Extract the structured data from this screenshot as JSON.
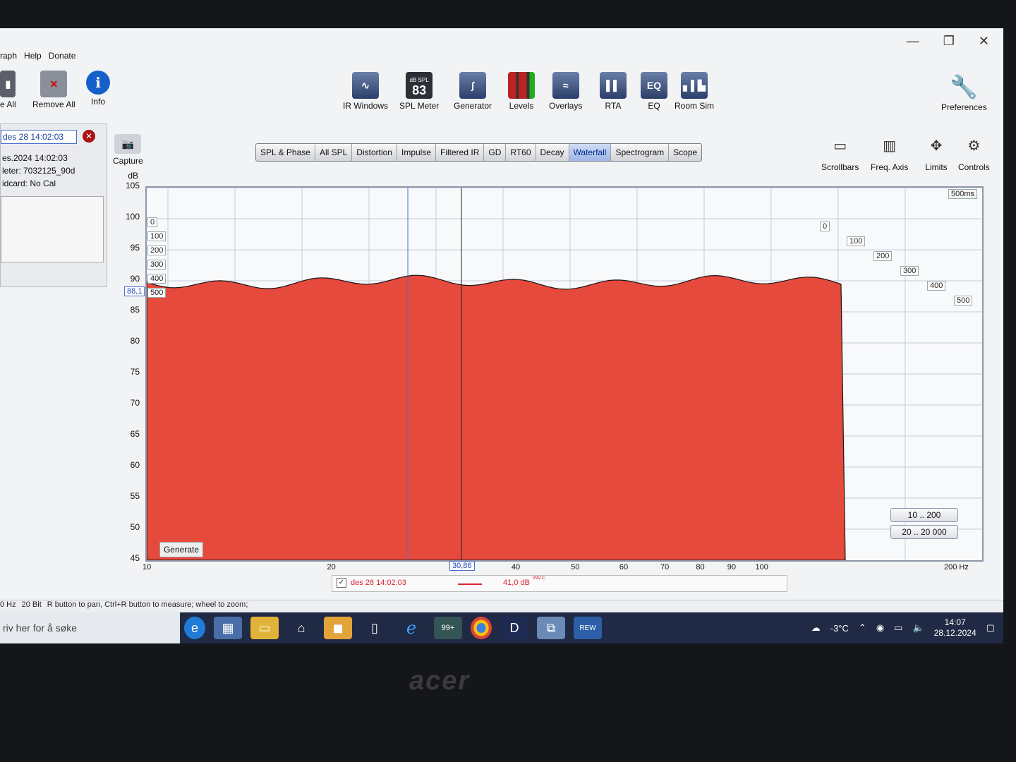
{
  "menu": [
    "raph",
    "Help",
    "Donate"
  ],
  "window_controls": [
    "—",
    "❐",
    "✕"
  ],
  "left_tools": [
    {
      "label": "e All",
      "icon": "save-all-icon"
    },
    {
      "label": "Remove All",
      "icon": "remove-all-icon"
    },
    {
      "label": "Info",
      "icon": "info-icon"
    }
  ],
  "main_tools": [
    {
      "label": "IR Windows",
      "icon": "ir-windows-icon"
    },
    {
      "label": "SPL Meter",
      "icon": "spl-meter-icon",
      "badge": "dB SPL",
      "value": "83"
    },
    {
      "label": "Generator",
      "icon": "generator-icon"
    },
    {
      "label": "Levels",
      "icon": "levels-icon"
    },
    {
      "label": "Overlays",
      "icon": "overlays-icon"
    },
    {
      "label": "RTA",
      "icon": "rta-icon"
    },
    {
      "label": "EQ",
      "icon": "eq-icon",
      "glyph": "EQ"
    },
    {
      "label": "Room Sim",
      "icon": "room-sim-icon"
    }
  ],
  "preferences_label": "Preferences",
  "capture_label": "Capture",
  "measurement": {
    "name": "des 28 14:02:03",
    "date": "es.2024 14:02:03",
    "meter": "leter: 7032125_90d",
    "soundcard": "idcard: No Cal"
  },
  "tabs": [
    "SPL & Phase",
    "All SPL",
    "Distortion",
    "Impulse",
    "Filtered IR",
    "GD",
    "RT60",
    "Decay",
    "Waterfall",
    "Spectrogram",
    "Scope"
  ],
  "active_tab": "Waterfall",
  "right_tools": [
    "Scrollbars",
    "Freq. Axis",
    "Limits",
    "Controls"
  ],
  "plot": {
    "y_unit": "dB",
    "y_ticks": [
      "105",
      "100",
      "95",
      "90",
      "85",
      "80",
      "75",
      "70",
      "65",
      "60",
      "55",
      "50",
      "45"
    ],
    "x_ticks": [
      "10",
      "20",
      "40",
      "50",
      "60",
      "70",
      "80",
      "90",
      "100"
    ],
    "x_max_label": "200 Hz",
    "cursor_freq": "30,86",
    "cursor_level": "88,1",
    "time_label": "500ms",
    "time_ticks": [
      "0",
      "100",
      "200",
      "300",
      "400",
      "500"
    ],
    "range_boxes": [
      "10 .. 200",
      "20 .. 20 000"
    ],
    "generate_label": "Generate",
    "fill_color": "#e64a3c",
    "line_color": "#151515"
  },
  "legend": {
    "name": "des 28 14:02:03",
    "value": "41,0 dB",
    "sup": "INV.C"
  },
  "status": [
    "0 Hz",
    "20 Bit",
    "R button to pan, Ctrl+R button to measure; wheel to zoom;"
  ],
  "taskbar": {
    "search": "riv her for å søke",
    "badge": "99+",
    "weather": "-3°C",
    "time": "14:07",
    "date": "28.12.2024"
  },
  "brand": "acer"
}
